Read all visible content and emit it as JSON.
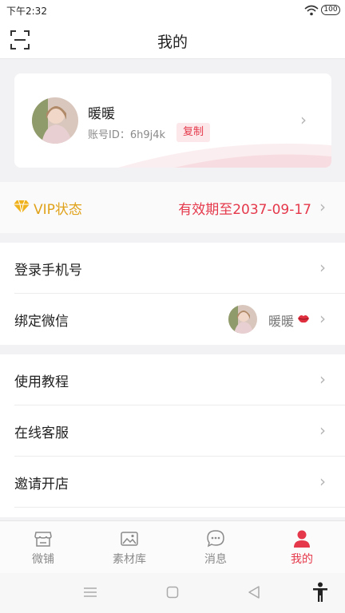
{
  "status_bar": {
    "time": "下午2:32",
    "battery": "100"
  },
  "header": {
    "title": "我的"
  },
  "profile": {
    "nickname": "暖暖",
    "account_id": "账号ID：6h9j4k",
    "copy_label": "复制"
  },
  "vip": {
    "label": "VIP状态",
    "expiry": "有效期至2037-09-17"
  },
  "account_rows": [
    {
      "label": "登录手机号"
    },
    {
      "label": "绑定微信",
      "value": "暖暖"
    }
  ],
  "service_rows": [
    {
      "label": "使用教程"
    },
    {
      "label": "在线客服"
    },
    {
      "label": "邀请开店"
    }
  ],
  "tabs": [
    {
      "label": "微铺",
      "icon": "shop-icon"
    },
    {
      "label": "素材库",
      "icon": "image-icon"
    },
    {
      "label": "消息",
      "icon": "chat-icon"
    },
    {
      "label": "我的",
      "icon": "person-icon",
      "active": true
    }
  ],
  "colors": {
    "accent": "#e5394b",
    "vip_gold": "#e0a21a",
    "background": "#f2f2f4"
  }
}
